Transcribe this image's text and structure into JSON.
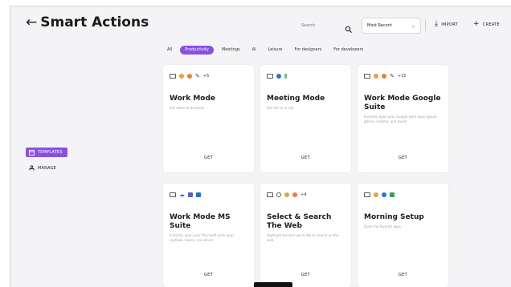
{
  "header": {
    "title": "Smart Actions",
    "back_icon": "arrow-left-icon"
  },
  "search": {
    "placeholder": "Search"
  },
  "sort": {
    "selected": "Most Recent"
  },
  "actions": {
    "import_label": "IMPORT",
    "create_label": "CREATE"
  },
  "filters": [
    "All",
    "Productivity",
    "Meetings",
    "AI",
    "Leisure",
    "For designers",
    "For developers"
  ],
  "sidebar": {
    "templates_label": "TEMPLATES",
    "manage_label": "MANAGE"
  },
  "cards": [
    {
      "title": "Work Mode",
      "description": "Get down to business.",
      "icons_more": "+5",
      "get": "GET"
    },
    {
      "title": "Meeting Mode",
      "description": "Get set for a call.",
      "icons_more": "",
      "get": "GET"
    },
    {
      "title": "Work Mode Google Suite",
      "description": "Instantly open your Google work apps (gmail, gdrive, chrome, and more)",
      "icons_more": "+15",
      "get": "GET"
    },
    {
      "title": "Work Mode MS Suite",
      "description": "Instantly open your Microsoft work apps (outlook, teams, one drive)",
      "icons_more": "",
      "get": "GET"
    },
    {
      "title": "Select & Search The Web",
      "description": "Highlight the text you'd like to search on the web.",
      "icons_more": "+4",
      "get": "GET"
    },
    {
      "title": "Morning Setup",
      "description": "Open my favorite apps.",
      "icons_more": "",
      "get": "GET"
    }
  ],
  "colors": {
    "accent": "#8a50e6",
    "background": "#f4f4f6",
    "card": "#ffffff"
  }
}
